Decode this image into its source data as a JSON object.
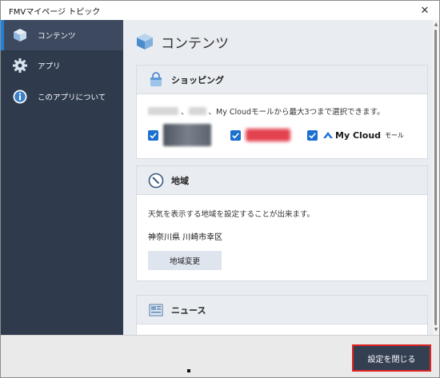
{
  "window": {
    "title": "FMVマイページ トピック"
  },
  "sidebar": {
    "items": [
      {
        "label": "コンテンツ",
        "icon": "cube-icon",
        "active": true
      },
      {
        "label": "アプリ",
        "icon": "gear-icon",
        "active": false
      },
      {
        "label": "このアプリについて",
        "icon": "info-icon",
        "active": false
      }
    ]
  },
  "main": {
    "title": "コンテンツ",
    "shopping": {
      "heading": "ショッピング",
      "desc_sep": "、",
      "desc_text": "、My Cloudモールから最大3つまで選択できます。",
      "option3": {
        "brand": "My Cloud",
        "sub": "モール"
      }
    },
    "region": {
      "heading": "地域",
      "description": "天気を表示する地域を設定することが出来ます。",
      "value": "神奈川県 川崎市幸区",
      "button_label": "地域変更"
    },
    "news": {
      "heading": "ニュース"
    }
  },
  "footer": {
    "close_label": "設定を閉じる"
  },
  "colors": {
    "sidebar_bg": "#2f3a4d",
    "accent": "#1f82d8",
    "checkbox": "#1a6fcf",
    "highlight_border": "#e02424"
  }
}
